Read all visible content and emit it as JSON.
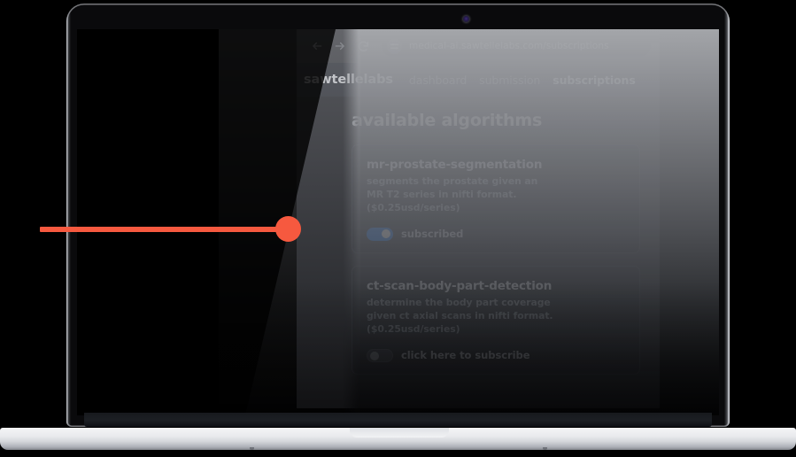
{
  "browser": {
    "back_icon": "arrow-left-icon",
    "forward_icon": "arrow-right-icon",
    "reload_icon": "reload-icon",
    "site_settings_icon": "sliders-icon",
    "url": "medical-ai.sawtellelabs.com/subscriptions"
  },
  "site": {
    "brand": "sawtellelabs",
    "nav": [
      {
        "label": "dashboard",
        "active": false
      },
      {
        "label": "submission",
        "active": false
      },
      {
        "label": "subscriptions",
        "active": true
      }
    ]
  },
  "page": {
    "title": "available algorithms",
    "cards": [
      {
        "name": "mr-prostate-segmentation",
        "description": "segments the prostate given an\nMR T2 series in nifti format.\n($0.25usd/series)",
        "price": "($0.25usd/series)",
        "toggle_state": "on",
        "toggle_label": "subscribed"
      },
      {
        "name": "ct-scan-body-part-detection",
        "description": "determine the body part coverage\ngiven ct axial scans in nifti format.\n($0.25usd/series)",
        "price": "($0.25usd/series)",
        "toggle_state": "off",
        "toggle_label": "click here to subscribe"
      }
    ]
  },
  "annotation": {
    "type": "pointer-line",
    "color": "#f6593f",
    "target": "subscribed-toggle"
  },
  "device": {
    "type": "laptop",
    "webcam": "webcam-dot"
  },
  "colors": {
    "page_background": "#26272b",
    "nav_background": "#2c2f36",
    "card_background": "#212328",
    "card_border": "#34373e",
    "toolbar_background": "#3a3b3f",
    "toggle_on": "#1474f2",
    "toggle_off": "#383a40",
    "accent_annotation": "#f6593f",
    "text_primary": "#e4e7ec",
    "text_secondary": "#9ca2ac"
  }
}
